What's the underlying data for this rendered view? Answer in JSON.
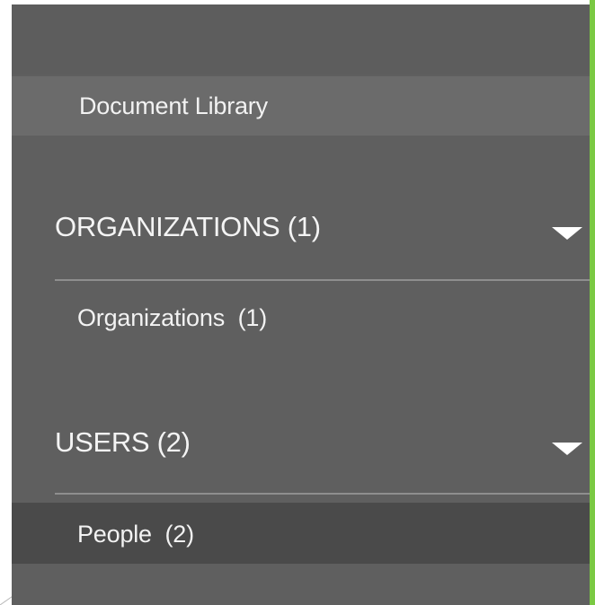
{
  "sidebar": {
    "document_library": {
      "label": "Document Library"
    },
    "sections": [
      {
        "title": "ORGANIZATIONS (1)",
        "icon": "chevron-down-icon",
        "items": [
          {
            "label": "Organizations  (1)"
          }
        ]
      },
      {
        "title": "USERS (2)",
        "icon": "chevron-down-icon",
        "items": [
          {
            "label": "People  (2)",
            "selected": true
          }
        ]
      }
    ]
  },
  "colors": {
    "sidebar_bg": "#5f5f5f",
    "document_library_bg": "#6b6b6b",
    "selected_item_bg": "#4a4a4a",
    "accent": "#7ac943",
    "text": "#f2f2f2"
  }
}
